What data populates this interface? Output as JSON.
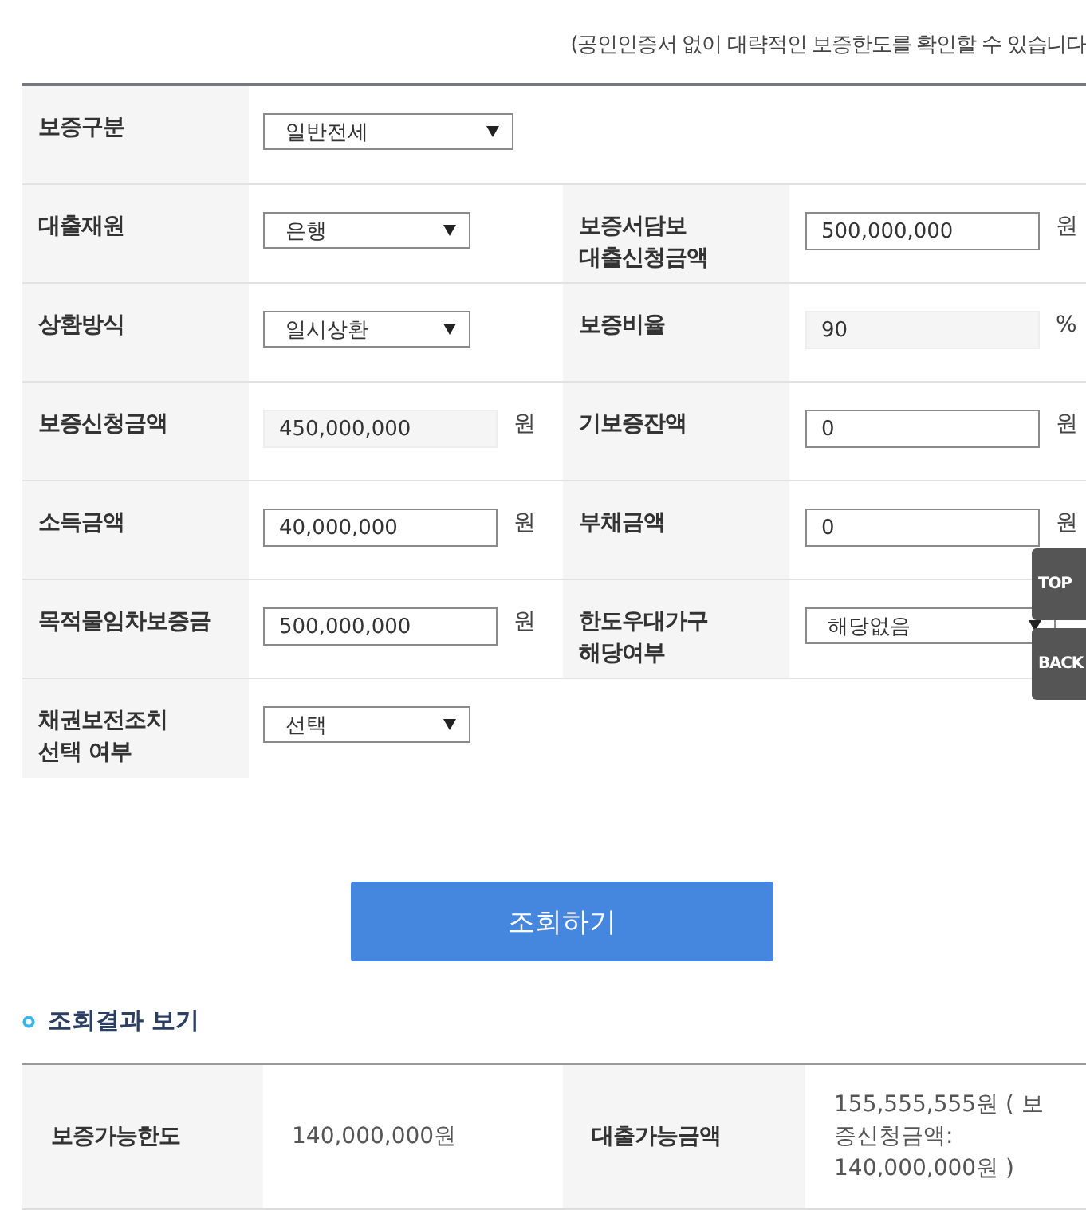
{
  "note": "(공인인증서 없이 대략적인 보증한도를 확인할 수 있습니다",
  "form": {
    "rows": [
      {
        "cells": [
          {
            "label": "보증구분",
            "field": {
              "kind": "select",
              "value": "일반전세"
            }
          }
        ]
      },
      {
        "cells": [
          {
            "label": "대출재원",
            "field": {
              "kind": "select",
              "value": "은행"
            }
          },
          {
            "label": "보증서담보\n대출신청금액",
            "field": {
              "kind": "input",
              "value": "500,000,000",
              "unit": "원"
            }
          }
        ]
      },
      {
        "cells": [
          {
            "label": "상환방식",
            "field": {
              "kind": "select",
              "value": "일시상환"
            }
          },
          {
            "label": "보증비율",
            "field": {
              "kind": "readonly",
              "value": "90",
              "unit": "%"
            }
          }
        ]
      },
      {
        "cells": [
          {
            "label": "보증신청금액",
            "field": {
              "kind": "readonly",
              "value": "450,000,000",
              "unit": "원"
            }
          },
          {
            "label": "기보증잔액",
            "field": {
              "kind": "input",
              "value": "0",
              "unit": "원"
            }
          }
        ]
      },
      {
        "cells": [
          {
            "label": "소득금액",
            "field": {
              "kind": "input",
              "value": "40,000,000",
              "unit": "원"
            }
          },
          {
            "label": "부채금액",
            "field": {
              "kind": "input",
              "value": "0",
              "unit": "원"
            }
          }
        ]
      },
      {
        "cells": [
          {
            "label": "목적물임차보증금",
            "field": {
              "kind": "input",
              "value": "500,000,000",
              "unit": "원"
            }
          },
          {
            "label": "한도우대가구\n해당여부",
            "field": {
              "kind": "select",
              "value": "해당없음"
            }
          }
        ]
      },
      {
        "cells": [
          {
            "label": "채권보전조치\n선택 여부",
            "field": {
              "kind": "select",
              "value": "선택"
            }
          }
        ]
      }
    ]
  },
  "submit_button": "조회하기",
  "results": {
    "title": "조회결과 보기",
    "cells": [
      {
        "label": "보증가능한도",
        "value": "140,000,000원"
      },
      {
        "label": "대출가능금액",
        "value": "155,555,555원 ( 보증신청금액: 140,000,000원 )"
      }
    ]
  },
  "side_buttons": [
    "TOP",
    "BACK"
  ]
}
